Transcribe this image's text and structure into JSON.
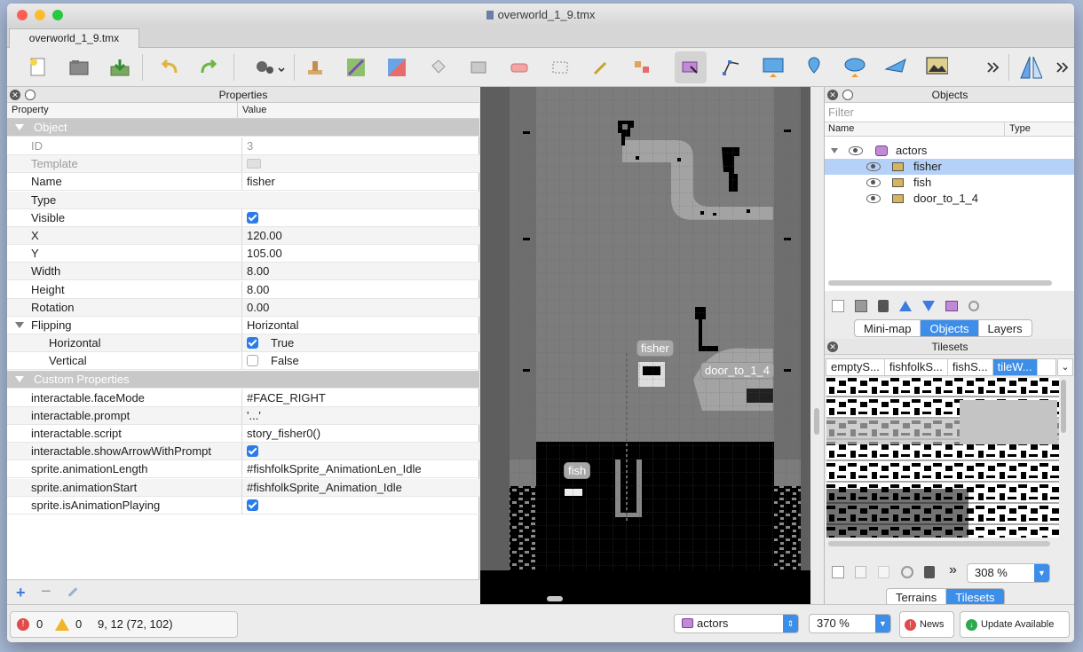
{
  "window": {
    "title": "overworld_1_9.tmx",
    "tab": "overworld_1_9.tmx"
  },
  "properties": {
    "title": "Properties",
    "col_property": "Property",
    "col_value": "Value",
    "rows": [
      {
        "key": "Object",
        "value": "",
        "group": true
      },
      {
        "key": "ID",
        "value": "3",
        "dim": true
      },
      {
        "key": "Template",
        "value": "",
        "dim": true,
        "icon": "template-icon"
      },
      {
        "key": "Name",
        "value": "fisher"
      },
      {
        "key": "Type",
        "value": ""
      },
      {
        "key": "Visible",
        "value": "",
        "check": true
      },
      {
        "key": "X",
        "value": "120.00"
      },
      {
        "key": "Y",
        "value": "105.00"
      },
      {
        "key": "Width",
        "value": "8.00"
      },
      {
        "key": "Height",
        "value": "8.00"
      },
      {
        "key": "Rotation",
        "value": "0.00"
      },
      {
        "key": "Flipping",
        "value": "Horizontal",
        "expand": true
      },
      {
        "key": "Horizontal",
        "value": "True",
        "check": true,
        "indent": true
      },
      {
        "key": "Vertical",
        "value": "False",
        "uncheck": true,
        "indent": true
      },
      {
        "key": "Custom Properties",
        "value": "",
        "group": true
      },
      {
        "key": "interactable.faceMode",
        "value": "#FACE_RIGHT"
      },
      {
        "key": "interactable.prompt",
        "value": "'...'"
      },
      {
        "key": "interactable.script",
        "value": "story_fisher0()"
      },
      {
        "key": "interactable.showArrowWithPrompt",
        "value": "",
        "check": true
      },
      {
        "key": "sprite.animationLength",
        "value": "#fishfolkSprite_AnimationLen_Idle"
      },
      {
        "key": "sprite.animationStart",
        "value": "#fishfolkSprite_Animation_Idle"
      },
      {
        "key": "sprite.isAnimationPlaying",
        "value": "",
        "check": true
      }
    ]
  },
  "map": {
    "labels": {
      "fisher": "fisher",
      "door": "door_to_1_4",
      "fish": "fish"
    }
  },
  "objects": {
    "title": "Objects",
    "filter_placeholder": "Filter",
    "col_name": "Name",
    "col_type": "Type",
    "layer": "actors",
    "items": [
      "fisher",
      "fish",
      "door_to_1_4"
    ],
    "tabs": [
      "Mini-map",
      "Objects",
      "Layers"
    ]
  },
  "tilesets": {
    "title": "Tilesets",
    "tabs": [
      "emptyS...",
      "fishfolkS...",
      "fishS...",
      "tileW..."
    ],
    "zoom": "308 %",
    "bottom_tabs": [
      "Terrains",
      "Tilesets"
    ]
  },
  "status": {
    "errors": "0",
    "warnings": "0",
    "coords": "9, 12 (72, 102)",
    "layer": "actors",
    "zoom": "370 %",
    "news": "News",
    "update": "Update Available"
  },
  "colors": {
    "accent": "#3d8ee8",
    "selection": "#b6d1f7",
    "error": "#e14b4b",
    "warning": "#f0b429"
  }
}
